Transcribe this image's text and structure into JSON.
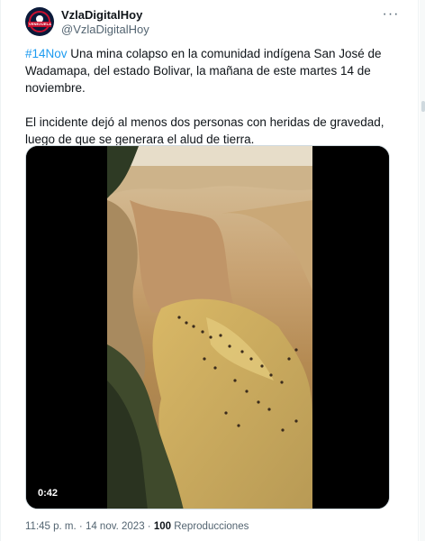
{
  "account": {
    "display_name": "VzlaDigitalHoy",
    "handle": "@VzlaDigitalHoy",
    "avatar_text": "VENEZUELA"
  },
  "more_icon": "more-horizontal-icon",
  "tweet": {
    "hashtag": "#14Nov",
    "paragraph1_rest": " Una mina colapso en la comunidad indígena San José de Wadamapa, del estado Bolivar, la mañana de este martes 14 de noviembre.",
    "paragraph2": "El incidente dejó al menos dos personas con heridas de gravedad, luego de que se generara el alud de tierra."
  },
  "video": {
    "duration": "0:42"
  },
  "meta": {
    "time": "11:45 p. m.",
    "separator": "·",
    "date": "14 nov. 2023",
    "views_count": "100",
    "views_label": "Reproducciones"
  },
  "colors": {
    "link": "#1d9bf0",
    "text": "#0f1419",
    "secondary": "#536471"
  }
}
